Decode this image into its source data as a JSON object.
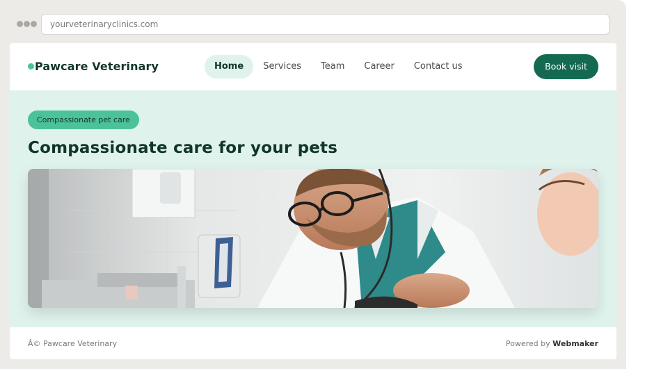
{
  "browser": {
    "url": "yourveterinaryclinics.com"
  },
  "header": {
    "brand": "Pawcare Veterinary",
    "nav": [
      {
        "label": "Home",
        "active": true
      },
      {
        "label": "Services",
        "active": false
      },
      {
        "label": "Team",
        "active": false
      },
      {
        "label": "Career",
        "active": false
      },
      {
        "label": "Contact us",
        "active": false
      }
    ],
    "cta_label": "Book visit"
  },
  "hero": {
    "badge": "Compassionate pet care",
    "title": "Compassionate care for your pets"
  },
  "footer": {
    "copyright": "Â© Pawcare Veterinary",
    "powered_prefix": "Powered by",
    "powered_brand": "Webmaker"
  },
  "colors": {
    "accent": "#136a51",
    "accent_light": "#4cc29a",
    "hero_bg": "#dff3ec",
    "frame_bg": "#ecebe7"
  }
}
